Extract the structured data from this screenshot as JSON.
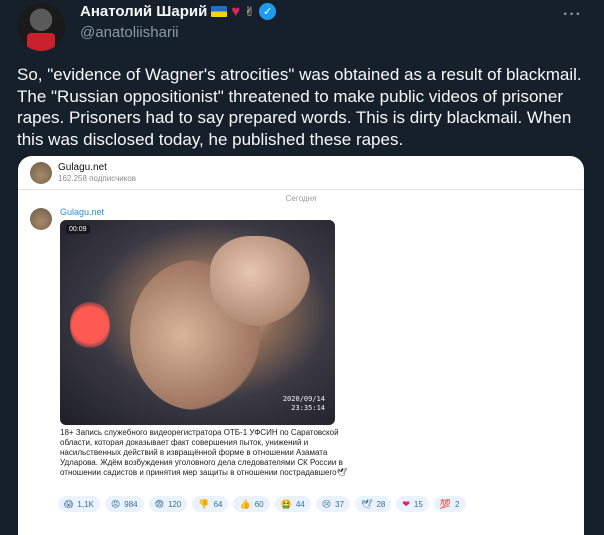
{
  "tweet": {
    "display_name": "Анатолий Шарий",
    "handle": "@anatoliisharii",
    "more_label": "···",
    "text": "So, \"evidence of Wagner's atrocities\" was obtained as a result of blackmail. The \"Russian oppositionist\" threatened to make public videos of prisoner rapes. Prisoners had to say prepared words. This is dirty blackmail. When this was disclosed today, he published these rapes."
  },
  "media": {
    "channel_name": "Gulagu.net",
    "channel_subs": "162.258 подписчиков",
    "date_divider": "Сегодня",
    "post_author": "Gulagu.net",
    "video_duration": "00:09",
    "video_stamp_date": "2020/09/14",
    "video_stamp_time": "23:35:14",
    "post_text": "18+ Запись служебного видеорегистратора ОТБ-1 УФСИН по Саратовской области, которая доказывает факт совершения пыток, унижений и насильственных действий в извращённой форме в отношении Азамата Удларова. Ждём возбуждения уголовного дела следователями СК России в отношении садистов и принятия мер защиты в отношении пострадавшего🕊",
    "reactions": [
      {
        "icon": "😱",
        "count": "1,1K"
      },
      {
        "icon": "😡",
        "count": "984"
      },
      {
        "icon": "😨",
        "count": "120"
      },
      {
        "icon": "👎",
        "count": "64"
      },
      {
        "icon": "👍",
        "count": "60"
      },
      {
        "icon": "🤮",
        "count": "44"
      },
      {
        "icon": "😢",
        "count": "37"
      },
      {
        "icon": "🕊",
        "count": "28"
      },
      {
        "icon": "❤",
        "count": "15"
      },
      {
        "icon": "💯",
        "count": "2"
      }
    ]
  }
}
